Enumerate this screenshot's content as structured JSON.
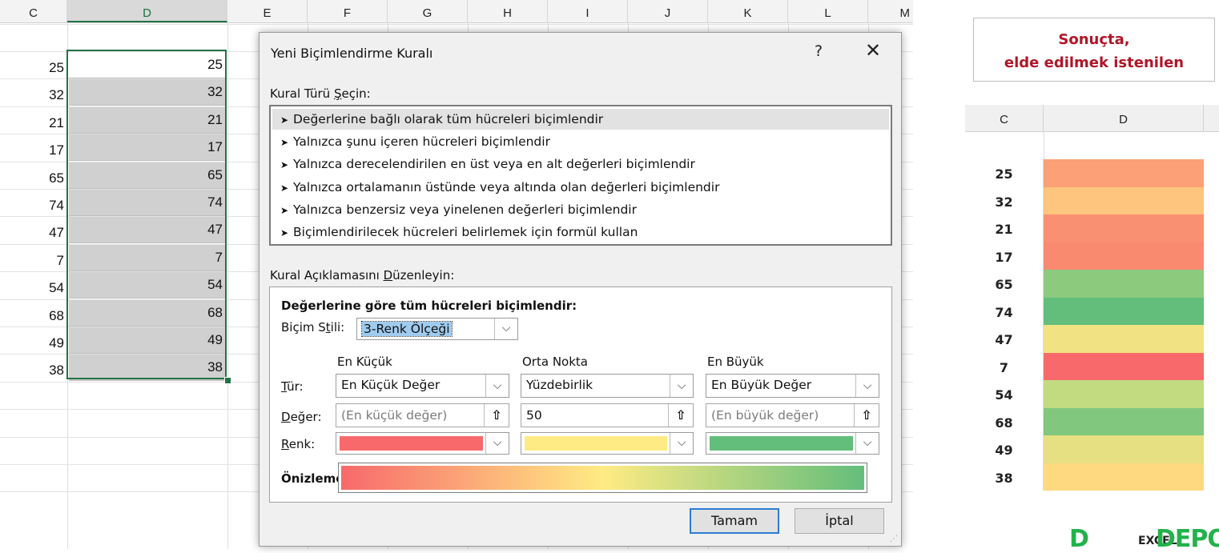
{
  "sheet": {
    "columns": [
      "C",
      "D",
      "E",
      "F",
      "G",
      "H",
      "I",
      "J",
      "K",
      "L",
      "M"
    ],
    "selected_column": "D",
    "values": [
      25,
      32,
      21,
      17,
      65,
      74,
      47,
      7,
      54,
      68,
      49,
      38
    ]
  },
  "dialog": {
    "title": "Yeni Biçimlendirme Kuralı",
    "help": "?",
    "close": "✕",
    "rule_type_label": "Kural Türü Seçin:",
    "rule_types": [
      "Değerlerine bağlı olarak tüm hücreleri biçimlendir",
      "Yalnızca şunu içeren hücreleri biçimlendir",
      "Yalnızca derecelendirilen en üst veya en alt değerleri biçimlendir",
      "Yalnızca ortalamanın üstünde veya altında olan değerleri biçimlendir",
      "Yalnızca benzersiz veya yinelenen değerleri biçimlendir",
      "Biçimlendirilecek hücreleri belirlemek için formül kullan"
    ],
    "selected_rule_index": 0,
    "desc_label": "Kural Açıklamasını Düzenleyin:",
    "desc_heading": "Değerlerine göre tüm hücreleri biçimlendir:",
    "style_label": "Biçim Stili:",
    "style_value": "3-Renk Ölçeği",
    "col_headers": [
      "En Küçük",
      "Orta Nokta",
      "En Büyük"
    ],
    "row_labels": {
      "type": "Tür:",
      "value": "Değer:",
      "color": "Renk:"
    },
    "types": [
      "En Küçük Değer",
      "Yüzdebirlik",
      "En Büyük Değer"
    ],
    "values": [
      "",
      "50",
      ""
    ],
    "value_placeholders": [
      "(En küçük değer)",
      "",
      "(En büyük değer)"
    ],
    "colors": [
      "#f8696b",
      "#ffeb84",
      "#63be7b"
    ],
    "preview_label": "Önizleme:",
    "ok": "Tamam",
    "cancel": "İptal"
  },
  "result": {
    "note_line1": "Sonuçta,",
    "note_line2": "elde edilmek istenilen",
    "columns": [
      "C",
      "D"
    ],
    "rows": [
      {
        "value": "25",
        "color": "#fba077"
      },
      {
        "value": "32",
        "color": "#fdc57d"
      },
      {
        "value": "21",
        "color": "#fa9072"
      },
      {
        "value": "17",
        "color": "#f98a70"
      },
      {
        "value": "65",
        "color": "#8ccb7e"
      },
      {
        "value": "74",
        "color": "#63be7b"
      },
      {
        "value": "47",
        "color": "#f1e383"
      },
      {
        "value": "7",
        "color": "#f8696b"
      },
      {
        "value": "54",
        "color": "#c2db81"
      },
      {
        "value": "68",
        "color": "#81c77d"
      },
      {
        "value": "49",
        "color": "#e6e082"
      },
      {
        "value": "38",
        "color": "#fed980"
      }
    ]
  },
  "watermark": {
    "part1": "D",
    "part2": "EXCEL",
    "part3": "DEPO"
  }
}
